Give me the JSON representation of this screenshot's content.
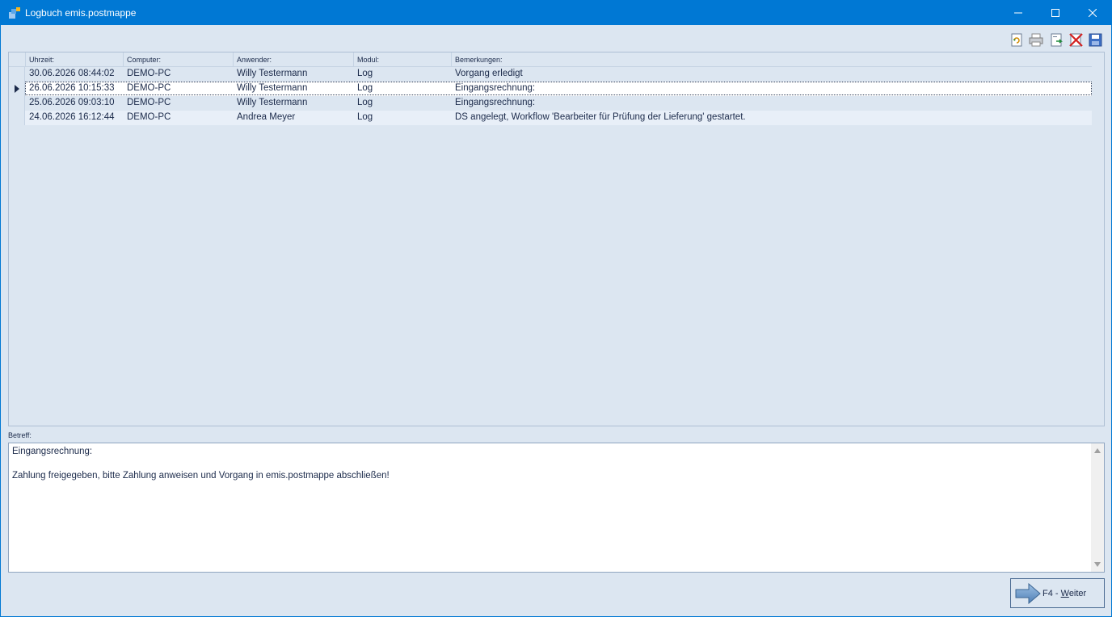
{
  "window": {
    "title": "Logbuch emis.postmappe",
    "app_icon": "app-logo-icon"
  },
  "toolbar": {
    "icons": [
      "refresh-document-icon",
      "print-icon",
      "export-excel-icon",
      "delete-icon",
      "save-icon"
    ]
  },
  "grid": {
    "columns": [
      "Uhrzeit:",
      "Computer:",
      "Anwender:",
      "Modul:",
      "Bemerkungen:"
    ],
    "rows": [
      {
        "time": "30.06.2026 08:44:02",
        "computer": "DEMO-PC",
        "user": "Willy Testermann",
        "module": "Log",
        "remark": "Vorgang erledigt"
      },
      {
        "time": "26.06.2026 10:15:33",
        "computer": "DEMO-PC",
        "user": "Willy Testermann",
        "module": "Log",
        "remark": "Eingangsrechnung:"
      },
      {
        "time": "25.06.2026 09:03:10",
        "computer": "DEMO-PC",
        "user": "Willy Testermann",
        "module": "Log",
        "remark": "Eingangsrechnung:"
      },
      {
        "time": "24.06.2026 16:12:44",
        "computer": "DEMO-PC",
        "user": "Andrea Meyer",
        "module": "Log",
        "remark": "DS angelegt, Workflow 'Bearbeiter für Prüfung der Lieferung' gestartet."
      }
    ],
    "selected_row": 1
  },
  "betreff": {
    "label": "Betreff:",
    "text": "Eingangsrechnung:\n\nZahlung freigegeben, bitte Zahlung anweisen und Vorgang in emis.postmappe abschließen!"
  },
  "next_button": {
    "prefix": "F4 - ",
    "mnemonic": "W",
    "rest": "eiter"
  },
  "colors": {
    "titlebar": "#0078d4",
    "background": "#dce6f1",
    "text": "#1b2a4a"
  }
}
